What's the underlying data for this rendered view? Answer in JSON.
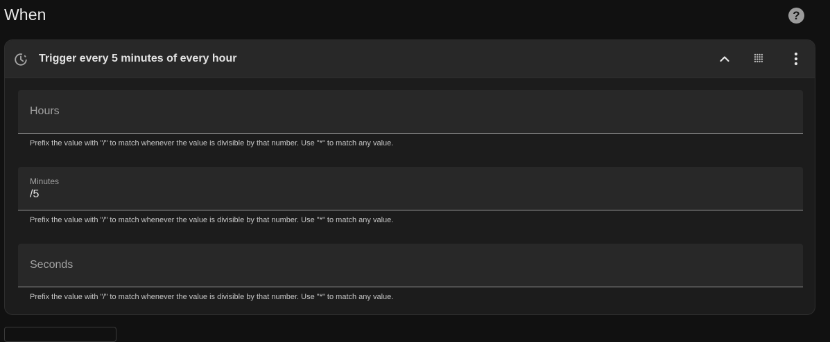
{
  "section": {
    "title": "When",
    "help_icon": "help-circle-icon",
    "help_glyph": "?"
  },
  "trigger": {
    "icon": "timer-clock-icon",
    "title": "Trigger every 5 minutes of every hour",
    "actions": [
      "chevron-up-icon",
      "drag-handle-icon",
      "more-vertical-icon"
    ]
  },
  "fields": [
    {
      "label": "Hours",
      "value": "",
      "helper": "Prefix the value with \"/\" to match whenever the value is divisible by that number. Use \"*\" to match any value."
    },
    {
      "label": "Minutes",
      "value": "/5",
      "helper": "Prefix the value with \"/\" to match whenever the value is divisible by that number. Use \"*\" to match any value."
    },
    {
      "label": "Seconds",
      "value": "",
      "helper": "Prefix the value with \"/\" to match whenever the value is divisible by that number. Use \"*\" to match any value."
    }
  ],
  "colors": {
    "background": "#111111",
    "card": "#1c1c1c",
    "header": "#282828",
    "field": "#282828",
    "text": "#e1e1e1",
    "muted": "#a2a2a2"
  }
}
